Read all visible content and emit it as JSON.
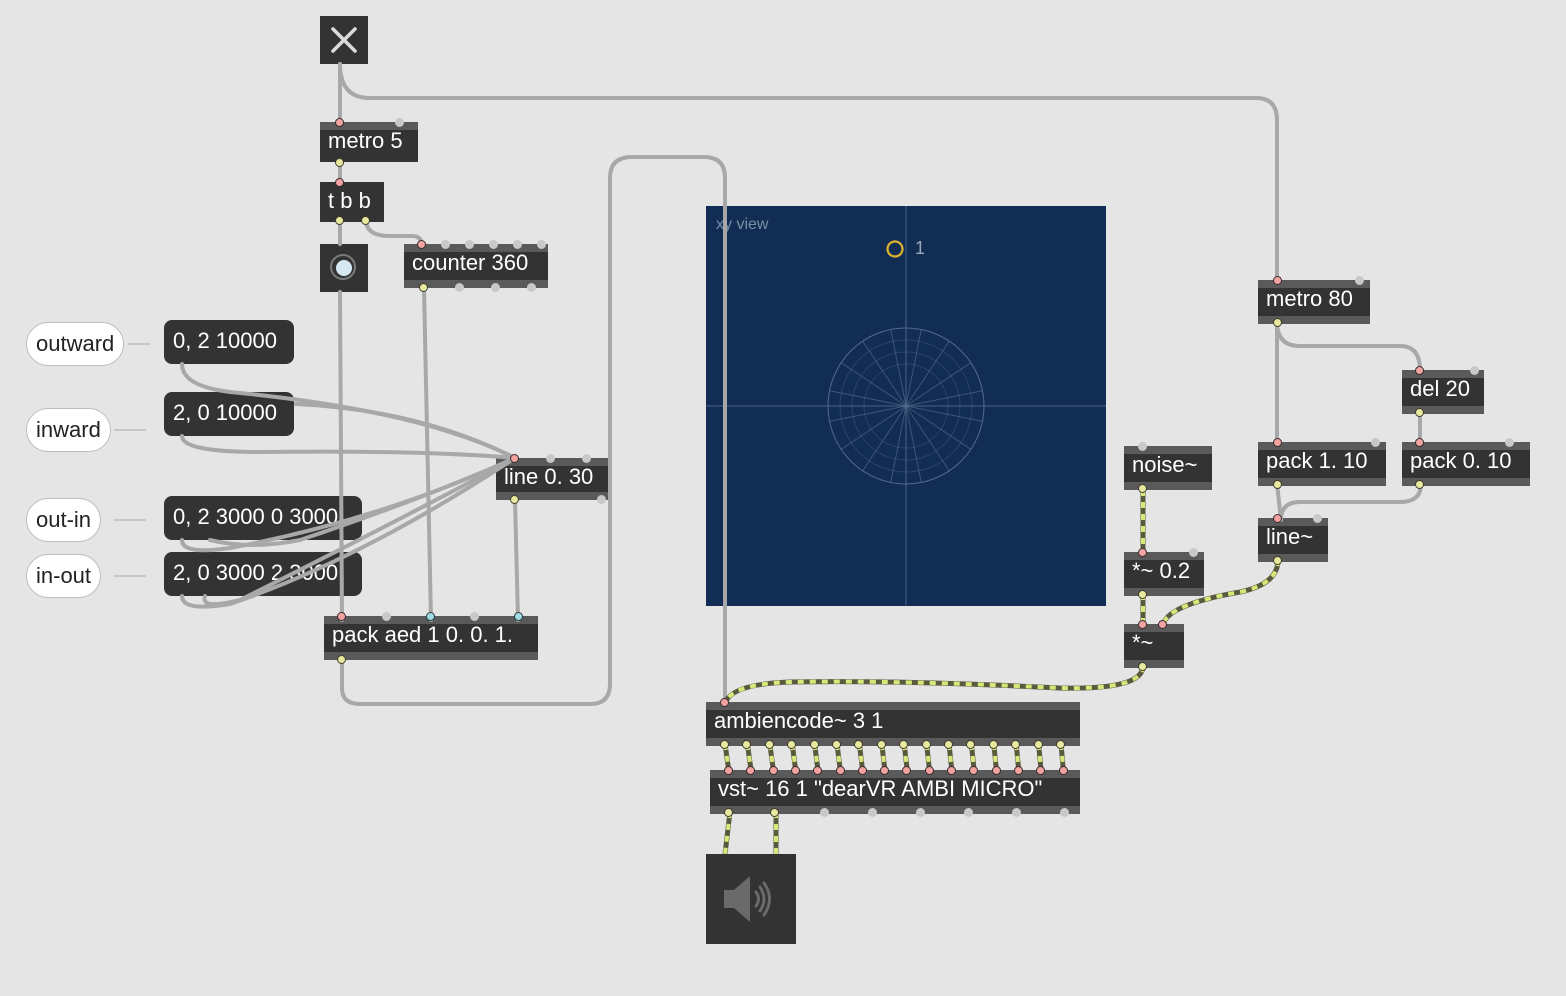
{
  "toggle": {
    "icon": "close-x-icon",
    "state": "on"
  },
  "bang": {
    "icon": "bang-circle-icon"
  },
  "objects": {
    "metro5": "metro 5",
    "tbb": "t b b",
    "counter": "counter 360",
    "line_msg": "line 0. 30",
    "pack_aed": "pack aed 1 0. 0. 1.",
    "metro80": "metro 80",
    "del20": "del 20",
    "pack1": "pack 1. 10",
    "pack0": "pack 0. 10",
    "line_sig": "line~",
    "noise": "noise~",
    "mul02": "*~ 0.2",
    "mul": "*~",
    "ambiencode": "ambiencode~ 3 1",
    "vst": "vst~ 16 1 \"dearVR AMBI MICRO\""
  },
  "messages": {
    "m1": "0, 2 10000",
    "m2": "2, 0 10000",
    "m3": "0, 2 3000 0 3000",
    "m4": "2, 0 3000 2 3000"
  },
  "comments": {
    "outward": "outward",
    "inward": "inward",
    "out_in": "out-in",
    "in_out": "in-out"
  },
  "xyview": {
    "title": "xy view",
    "source_label": "1",
    "background": "#112d53",
    "source_color": "#e0b030"
  },
  "ezdac": {
    "icon": "speaker-icon"
  },
  "colors": {
    "canvas": "#e5e5e5",
    "object": "#333333",
    "signal_cord": "#d8e878",
    "control_cord": "#a8a8a8"
  }
}
